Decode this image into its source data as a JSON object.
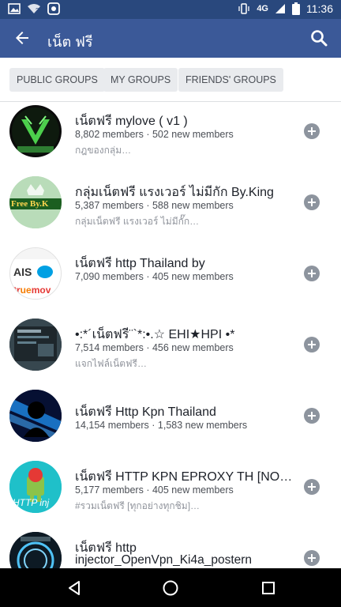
{
  "status_bar": {
    "network": "4G",
    "time": "11:36"
  },
  "header": {
    "title": "เน็ต ฟรี"
  },
  "filters": [
    {
      "label": "PUBLIC GROUPS"
    },
    {
      "label": "MY GROUPS"
    },
    {
      "label": "FRIENDS' GROUPS"
    }
  ],
  "groups": [
    {
      "name": "เน็ตฟรี mylove ( v1 )",
      "meta": "8,802 members · 502 new members",
      "desc": "กฎของกลุ่ม…",
      "avatar_text": ""
    },
    {
      "name": "กลุ่มเน็ตฟรี แรงเวอร์ ไม่มีกัก By.King",
      "meta": "5,387 members · 588 new members",
      "desc": "กลุ่มเน็ตฟรี แรงเวอร์ ไม่มีกั๊ก…",
      "avatar_text": "Free By.K"
    },
    {
      "name": "เน็ตฟรี http Thailand by",
      "meta": "7,090 members · 405 new members",
      "desc": "",
      "avatar_text": "AIS"
    },
    {
      "name": "•:*´เน็ตฟรี¨`*:•.☆ EHI★HPI •*",
      "meta": "7,514 members · 456 new members",
      "desc": "แจกไฟล์เน็ตฟรี…",
      "avatar_text": ""
    },
    {
      "name": "เน็ตฟรี Http Kpn Thailand",
      "meta": "14,154 members · 1,583 new members",
      "desc": "",
      "avatar_text": ""
    },
    {
      "name": "เน็ตฟรี HTTP KPN EPROXY TH [NO…",
      "meta": "5,177 members · 405 new members",
      "desc": "#รวมเน็ตฟรี [ทุกอย่างทุกชิม]…",
      "avatar_text": "HTTP inj"
    },
    {
      "name": "เน็ตฟรี http",
      "name2": "injector_OpenVpn_Ki4a_postern",
      "meta": "",
      "desc": "",
      "avatar_text": ""
    }
  ],
  "colors": {
    "facebook_blue": "#3b5998",
    "status_blue": "#29487d",
    "chip_bg": "#e9ebee",
    "add_icon": "#8d949e"
  }
}
